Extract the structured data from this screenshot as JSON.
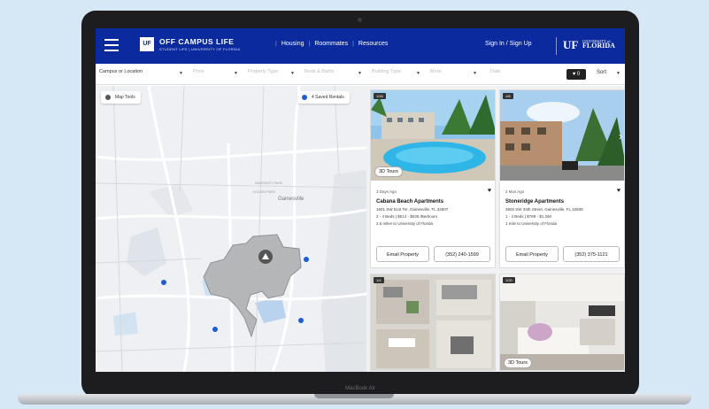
{
  "header": {
    "logo_letters": "UF",
    "brand": "OFF CAMPUS LIFE",
    "brand_sub": "STUDENT LIFE | UNIVERSITY OF FLORIDA",
    "nav": [
      "Housing",
      "Roommates",
      "Resources"
    ],
    "signin": "Sign In / Sign Up",
    "uf_mark": "UF",
    "uf_line1": "UNIVERSITY of",
    "uf_line2": "FLORIDA"
  },
  "filters": {
    "location": "Campus or Location",
    "price": "Price",
    "property_type": "Property Type",
    "beds_baths": "Beds & Baths",
    "building_type": "Building Type",
    "more": "More",
    "date": "Date",
    "favorites_count": "♥ 0",
    "sort": "Sort"
  },
  "map": {
    "map_tools": "Map Tools",
    "saved_rentals": "4 Saved Rentals",
    "city_label": "Gainesville",
    "campus_label": "UNIVERSITY PARK",
    "campus_label2": "GOLDEN PARK"
  },
  "listings": [
    {
      "tag": "1/16",
      "tours": "3D Tours",
      "posted": "3 Days Ago",
      "name": "Cabana Beach Apartments",
      "address": "1601 SW 51st Ter, Gainesville, FL 32607",
      "meta": "2 - 4 Beds  |  $514 - $635 /Bedroom",
      "distance": "2.5 miles to University of Florida",
      "email": "Email Property",
      "phone": "(352) 240-1599"
    },
    {
      "tag": "1/8",
      "tours": "",
      "posted": "2 Mos Ago",
      "name": "Stoneridge Apartments",
      "address": "3800 SW 34th Street, Gainesville, FL 32608",
      "meta": "1 - 4 Beds  |  $789 - $1,290",
      "distance": "1 mile to University of Florida",
      "email": "Email Property",
      "phone": "(352) 375-1121"
    },
    {
      "tag": "1/4",
      "tours": ""
    },
    {
      "tag": "1/20",
      "tours": "3D Tours"
    }
  ],
  "device": {
    "label": "MacBook Air"
  },
  "colors": {
    "brand_blue": "#0a2a9e",
    "map_marker": "#1e5bd6"
  }
}
